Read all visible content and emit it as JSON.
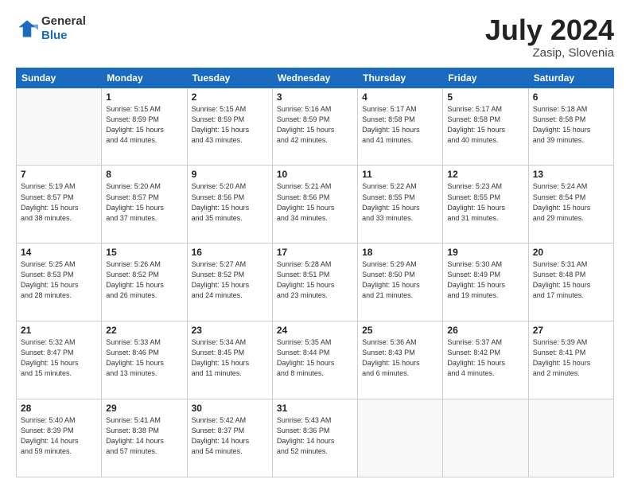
{
  "header": {
    "logo_line1": "General",
    "logo_line2": "Blue",
    "title": "July 2024",
    "location": "Zasip, Slovenia"
  },
  "weekdays": [
    "Sunday",
    "Monday",
    "Tuesday",
    "Wednesday",
    "Thursday",
    "Friday",
    "Saturday"
  ],
  "weeks": [
    [
      {
        "day": "",
        "info": ""
      },
      {
        "day": "1",
        "info": "Sunrise: 5:15 AM\nSunset: 8:59 PM\nDaylight: 15 hours\nand 44 minutes."
      },
      {
        "day": "2",
        "info": "Sunrise: 5:15 AM\nSunset: 8:59 PM\nDaylight: 15 hours\nand 43 minutes."
      },
      {
        "day": "3",
        "info": "Sunrise: 5:16 AM\nSunset: 8:59 PM\nDaylight: 15 hours\nand 42 minutes."
      },
      {
        "day": "4",
        "info": "Sunrise: 5:17 AM\nSunset: 8:58 PM\nDaylight: 15 hours\nand 41 minutes."
      },
      {
        "day": "5",
        "info": "Sunrise: 5:17 AM\nSunset: 8:58 PM\nDaylight: 15 hours\nand 40 minutes."
      },
      {
        "day": "6",
        "info": "Sunrise: 5:18 AM\nSunset: 8:58 PM\nDaylight: 15 hours\nand 39 minutes."
      }
    ],
    [
      {
        "day": "7",
        "info": "Sunrise: 5:19 AM\nSunset: 8:57 PM\nDaylight: 15 hours\nand 38 minutes."
      },
      {
        "day": "8",
        "info": "Sunrise: 5:20 AM\nSunset: 8:57 PM\nDaylight: 15 hours\nand 37 minutes."
      },
      {
        "day": "9",
        "info": "Sunrise: 5:20 AM\nSunset: 8:56 PM\nDaylight: 15 hours\nand 35 minutes."
      },
      {
        "day": "10",
        "info": "Sunrise: 5:21 AM\nSunset: 8:56 PM\nDaylight: 15 hours\nand 34 minutes."
      },
      {
        "day": "11",
        "info": "Sunrise: 5:22 AM\nSunset: 8:55 PM\nDaylight: 15 hours\nand 33 minutes."
      },
      {
        "day": "12",
        "info": "Sunrise: 5:23 AM\nSunset: 8:55 PM\nDaylight: 15 hours\nand 31 minutes."
      },
      {
        "day": "13",
        "info": "Sunrise: 5:24 AM\nSunset: 8:54 PM\nDaylight: 15 hours\nand 29 minutes."
      }
    ],
    [
      {
        "day": "14",
        "info": "Sunrise: 5:25 AM\nSunset: 8:53 PM\nDaylight: 15 hours\nand 28 minutes."
      },
      {
        "day": "15",
        "info": "Sunrise: 5:26 AM\nSunset: 8:52 PM\nDaylight: 15 hours\nand 26 minutes."
      },
      {
        "day": "16",
        "info": "Sunrise: 5:27 AM\nSunset: 8:52 PM\nDaylight: 15 hours\nand 24 minutes."
      },
      {
        "day": "17",
        "info": "Sunrise: 5:28 AM\nSunset: 8:51 PM\nDaylight: 15 hours\nand 23 minutes."
      },
      {
        "day": "18",
        "info": "Sunrise: 5:29 AM\nSunset: 8:50 PM\nDaylight: 15 hours\nand 21 minutes."
      },
      {
        "day": "19",
        "info": "Sunrise: 5:30 AM\nSunset: 8:49 PM\nDaylight: 15 hours\nand 19 minutes."
      },
      {
        "day": "20",
        "info": "Sunrise: 5:31 AM\nSunset: 8:48 PM\nDaylight: 15 hours\nand 17 minutes."
      }
    ],
    [
      {
        "day": "21",
        "info": "Sunrise: 5:32 AM\nSunset: 8:47 PM\nDaylight: 15 hours\nand 15 minutes."
      },
      {
        "day": "22",
        "info": "Sunrise: 5:33 AM\nSunset: 8:46 PM\nDaylight: 15 hours\nand 13 minutes."
      },
      {
        "day": "23",
        "info": "Sunrise: 5:34 AM\nSunset: 8:45 PM\nDaylight: 15 hours\nand 11 minutes."
      },
      {
        "day": "24",
        "info": "Sunrise: 5:35 AM\nSunset: 8:44 PM\nDaylight: 15 hours\nand 8 minutes."
      },
      {
        "day": "25",
        "info": "Sunrise: 5:36 AM\nSunset: 8:43 PM\nDaylight: 15 hours\nand 6 minutes."
      },
      {
        "day": "26",
        "info": "Sunrise: 5:37 AM\nSunset: 8:42 PM\nDaylight: 15 hours\nand 4 minutes."
      },
      {
        "day": "27",
        "info": "Sunrise: 5:39 AM\nSunset: 8:41 PM\nDaylight: 15 hours\nand 2 minutes."
      }
    ],
    [
      {
        "day": "28",
        "info": "Sunrise: 5:40 AM\nSunset: 8:39 PM\nDaylight: 14 hours\nand 59 minutes."
      },
      {
        "day": "29",
        "info": "Sunrise: 5:41 AM\nSunset: 8:38 PM\nDaylight: 14 hours\nand 57 minutes."
      },
      {
        "day": "30",
        "info": "Sunrise: 5:42 AM\nSunset: 8:37 PM\nDaylight: 14 hours\nand 54 minutes."
      },
      {
        "day": "31",
        "info": "Sunrise: 5:43 AM\nSunset: 8:36 PM\nDaylight: 14 hours\nand 52 minutes."
      },
      {
        "day": "",
        "info": ""
      },
      {
        "day": "",
        "info": ""
      },
      {
        "day": "",
        "info": ""
      }
    ]
  ]
}
